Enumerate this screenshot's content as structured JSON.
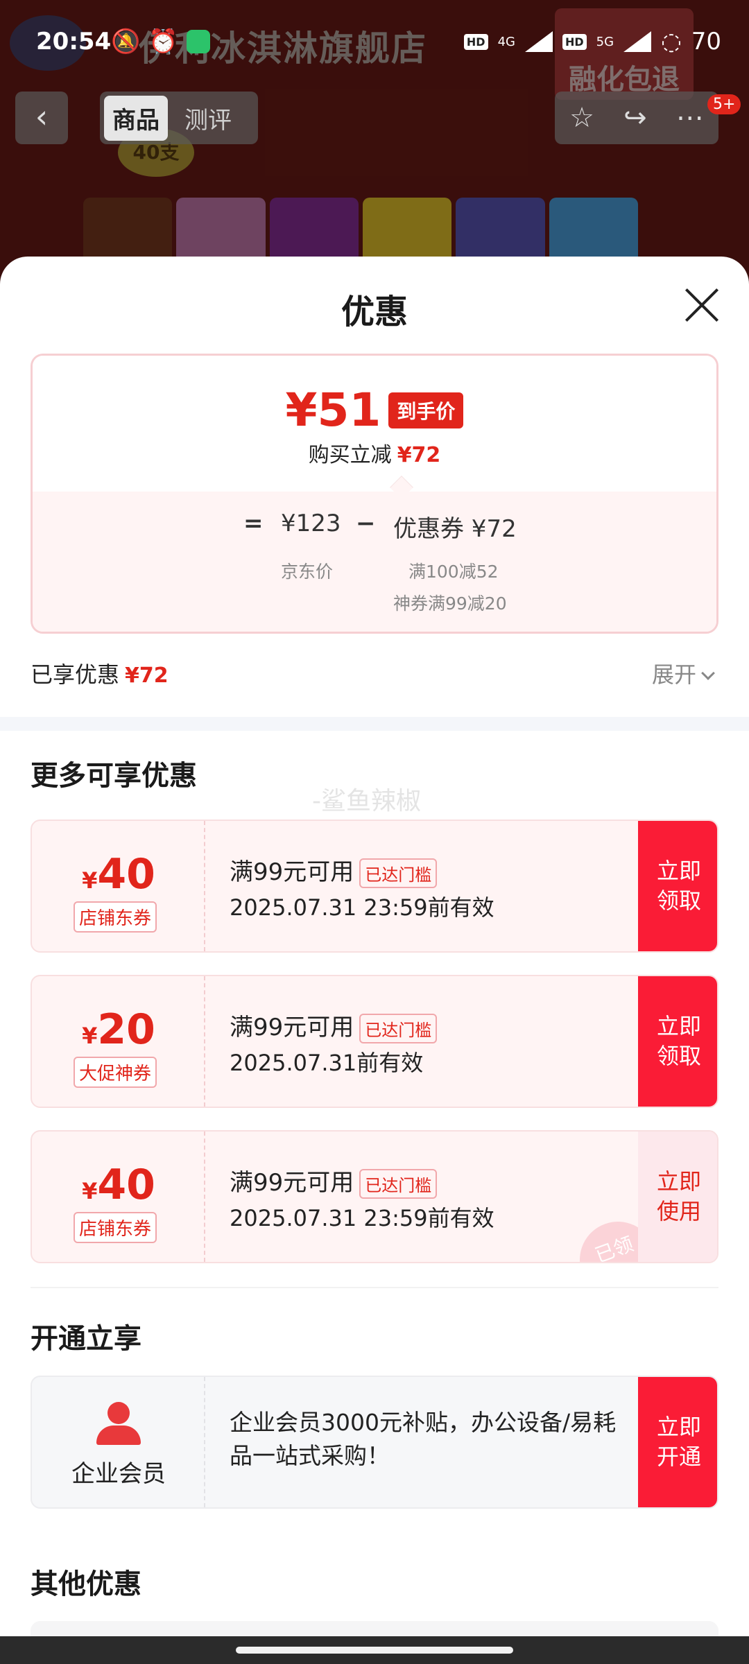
{
  "background": {
    "store_title": "伊利冰淇淋旗舰店",
    "promo_text": "融化包退",
    "count_badge": "40支",
    "tabs": [
      "商品",
      "测评"
    ],
    "notif_badge": "5+"
  },
  "status_bar": {
    "time": "20:54",
    "network1": "4G",
    "network2": "5G",
    "battery": "70"
  },
  "sheet": {
    "title": "优惠",
    "price_card": {
      "final_price": "¥51",
      "final_tag": "到手价",
      "instant_label": "购买立减",
      "instant_value": "¥72",
      "eq": "=",
      "jd_price": "¥123",
      "minus": "−",
      "coupon_label": "优惠券 ¥72",
      "jd_label": "京东价",
      "coupon_sub1": "满100减52",
      "coupon_sub2": "神券满99减20"
    },
    "enjoyed_label": "已享优惠",
    "enjoyed_value": "¥72",
    "expand_label": "展开",
    "more_title": "更多可享优惠",
    "watermark": "-鲨鱼辣椒",
    "coupons": [
      {
        "yen": "¥",
        "amount": "40",
        "type": "店铺东券",
        "condition": "满99元可用",
        "reached": "已达门槛",
        "validity": "2025.07.31 23:59前有效",
        "button": "立即\n领取",
        "used": false
      },
      {
        "yen": "¥",
        "amount": "20",
        "type": "大促神券",
        "condition": "满99元可用",
        "reached": "已达门槛",
        "validity": "2025.07.31前有效",
        "button": "立即\n领取",
        "used": false
      },
      {
        "yen": "¥",
        "amount": "40",
        "type": "店铺东券",
        "condition": "满99元可用",
        "reached": "已达门槛",
        "validity": "2025.07.31 23:59前有效",
        "button": "立即\n使用",
        "used": true,
        "stamp": "已领"
      }
    ],
    "open_title": "开通立享",
    "member": {
      "label": "企业会员",
      "text": " 企业会员3000元补贴，办公设备/易耗品一站式采购！",
      "button": "立即\n开通"
    },
    "other_title": "其他优惠"
  },
  "colors": {
    "accent": "#e1251b",
    "button_red": "#fa1c36",
    "coupon_bg": "#fff4f4"
  }
}
